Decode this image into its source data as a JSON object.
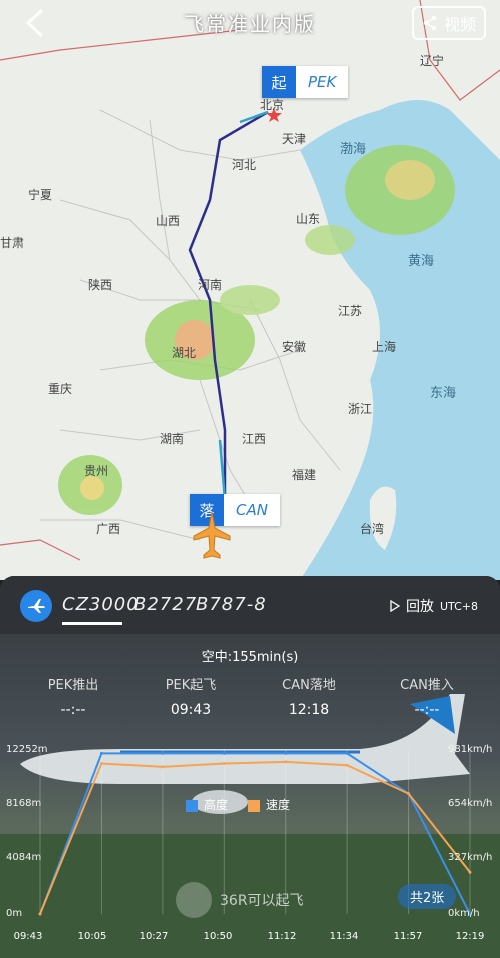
{
  "header": {
    "title": "飞常准业内版",
    "share_label": "视频"
  },
  "map": {
    "origin": {
      "badge": "起",
      "code": "PEK",
      "city": "北京"
    },
    "destination": {
      "badge": "落",
      "code": "CAN"
    },
    "provinces": [
      "辽宁",
      "天津",
      "渤海",
      "河北",
      "宁夏",
      "山西",
      "山东",
      "黄海",
      "陕西",
      "河南",
      "江苏",
      "湖北",
      "安徽",
      "上海",
      "重庆",
      "东海",
      "湖南",
      "江西",
      "浙江",
      "贵州",
      "福建",
      "广西",
      "台湾",
      "甘肃"
    ],
    "route_color": "#2d2d8a"
  },
  "flight": {
    "number": "CZ3000",
    "registration": "B2727",
    "aircraft": "B787-8",
    "replay_label": "回放",
    "tz": "UTC+8"
  },
  "status": {
    "air_time": "空中:155min(s)"
  },
  "events": [
    {
      "label": "PEK推出",
      "time": "--:--"
    },
    {
      "label": "PEK起飞",
      "time": "09:43"
    },
    {
      "label": "CAN落地",
      "time": "12:18"
    },
    {
      "label": "CAN推入",
      "time": "--:--"
    }
  ],
  "legend": {
    "altitude": "高度",
    "speed": "速度"
  },
  "colors": {
    "altitude": "#3a8fe8",
    "speed": "#f6a451"
  },
  "chart_data": {
    "type": "line",
    "x": [
      "09:43",
      "10:05",
      "10:27",
      "10:50",
      "11:12",
      "11:34",
      "11:57",
      "12:19"
    ],
    "y_left_ticks": [
      "12252m",
      "8168m",
      "4084m",
      "0m"
    ],
    "y_right_ticks": [
      "981km/h",
      "654km/h",
      "327km/h",
      "0km/h"
    ],
    "series": [
      {
        "name": "高度",
        "values": [
          0,
          12000,
          12000,
          12000,
          12000,
          12000,
          9000,
          0
        ]
      },
      {
        "name": "速度",
        "values": [
          0,
          900,
          880,
          900,
          910,
          890,
          720,
          250
        ]
      }
    ]
  },
  "watermark": {
    "text": "36R可以起飞",
    "count": "共2张"
  }
}
